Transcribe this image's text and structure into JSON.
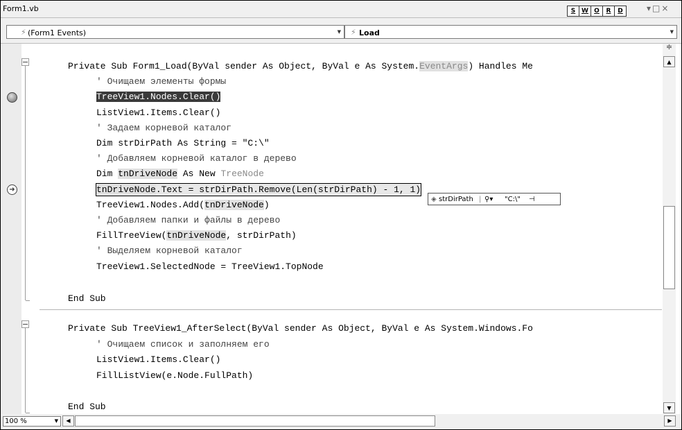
{
  "window": {
    "title": "Form1.vb",
    "view_buttons": [
      "S",
      "W",
      "O",
      "R",
      "D"
    ],
    "controls": "▾□×"
  },
  "nav": {
    "left_icon": "lightning-icon",
    "left_value": "(Form1 Events)",
    "right_icon": "lightning-icon",
    "right_value": "Load"
  },
  "code": {
    "l1a": "Private Sub Form1_Load(ByVal sender As Object, ByVal e As System.",
    "l1b": "EventArgs",
    "l1c": ") Handles Me",
    "l2": "' Очищаем элементы формы",
    "l3": "TreeView1.Nodes.Clear()",
    "l4": "ListView1.Items.Clear()",
    "l5": "' Задаем корневой каталог",
    "l6": "Dim strDirPath As String = \"C:\\\"",
    "l7": "' Добавляем корневой каталог в дерево",
    "l8a": "Dim ",
    "l8b": "tnDriveNode",
    "l8c": " As New ",
    "l8d": "TreeNode",
    "l9a": "tnDriveNode",
    "l9b": ".Text = strDirPath.Remove(Len(strDirPath) - 1, 1)",
    "l10a": "TreeView1.Nodes.Add(",
    "l10b": "tnDriveNode",
    "l10c": ")",
    "l11": "' Добавляем папки и файлы в дерево",
    "l12a": "FillTreeView(",
    "l12b": "tnDriveNode",
    "l12c": ", strDirPath)",
    "l13": "' Выделяем корневой каталог",
    "l14": "TreeView1.SelectedNode = TreeView1.TopNode",
    "l15": "End Sub",
    "l16": "Private Sub TreeView1_AfterSelect(ByVal sender As Object, ByVal e As System.Windows.Fo",
    "l17": "' Очищаем список и заполняем его",
    "l18": "ListView1.Items.Clear()",
    "l19": "FillListView(e.Node.FullPath)",
    "l20": "End Sub"
  },
  "datatip": {
    "name": "strDirPath",
    "value": "\"C:\\\"",
    "icon": "variable-icon",
    "magnifier_icon": "magnifier-icon",
    "pin_icon": "pin-icon"
  },
  "zoom": "100 %"
}
